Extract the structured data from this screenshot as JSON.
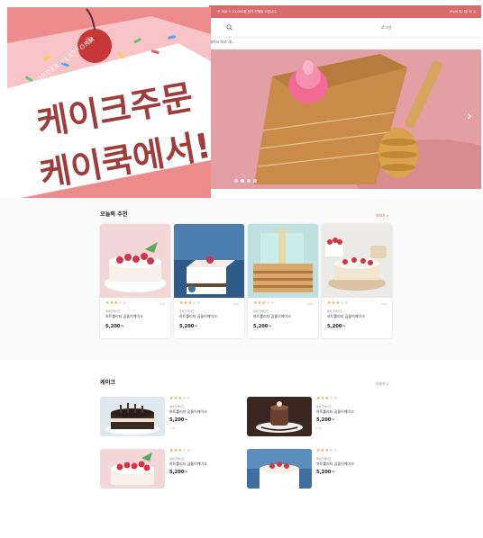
{
  "topbar": {
    "promo": "전 국내 스 21,000원 뭔가 진행을 드립니다.",
    "util": "My/0 피/ 피/ 피 ◎"
  },
  "header": {
    "login": "로그인",
    "nav": "케이크 하고 개..."
  },
  "logo": {
    "line1": "케이크주문",
    "line2": "케이쿡에서!",
    "sub": "CAKE ORDER PLATFORM"
  },
  "hero": {
    "arrow": "›",
    "slides": 4,
    "active_slide": 2
  },
  "recommend": {
    "title": "오늘의 추천",
    "more": "더보기 >",
    "items": [
      {
        "rating": 3,
        "count": "(14)",
        "shop": "제이크케이크",
        "name": "하트롤리타 곰돌이케이크",
        "price": "5,200~"
      },
      {
        "rating": 3,
        "count": "(14)",
        "shop": "제이크케이크",
        "name": "하트롤리타 곰돌이케이크",
        "price": "5,200~"
      },
      {
        "rating": 3,
        "count": "(14)",
        "shop": "제이크케이크",
        "name": "하트롤리타 곰돌이케이크",
        "price": "5,200~"
      },
      {
        "rating": 3,
        "count": "(14)",
        "shop": "제이크케이크",
        "name": "하트롤리타 곰돌이케이크",
        "price": "5,200~"
      }
    ]
  },
  "cake": {
    "title": "케이크",
    "more": "더보기 >",
    "items": [
      {
        "rating": 3,
        "shop": "제이크케이크",
        "name": "하트롤리타 곰돌이케이크",
        "price": "5,200~",
        "count": "(14)"
      },
      {
        "rating": 3,
        "shop": "제이크케이크",
        "name": "하트롤리타 곰돌이케이크",
        "price": "5,200~",
        "count": "(14)"
      },
      {
        "rating": 3,
        "shop": "제이크케이크",
        "name": "하트롤리타 곰돌이케이크",
        "price": "5,200~",
        "count": ""
      },
      {
        "rating": 3,
        "shop": "제이크케이크",
        "name": "하트롤리타 곰돌이케이크",
        "price": "5,200~",
        "count": ""
      }
    ]
  },
  "colors": {
    "accent": "#d96b6b",
    "brand_pink": "#ef8a8c",
    "star": "#e8a53b",
    "logo_text": "#9f3c3c"
  },
  "icons": {
    "search": "search-icon",
    "next": "chevron-right-icon"
  }
}
